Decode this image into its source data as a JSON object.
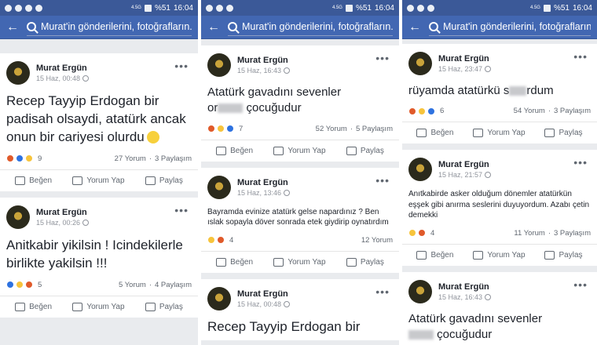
{
  "status": {
    "time": "16:04",
    "battery": "%51",
    "network": "4.5G"
  },
  "search": {
    "text": "Murat'in gönderilerini, fotoğrafların..."
  },
  "actions": {
    "like": "Beğen",
    "comment": "Yorum Yap",
    "share": "Paylaş"
  },
  "panels": [
    {
      "posts": [
        {
          "author": "Murat Ergün",
          "time": "15 Haz, 00:48",
          "text": "Recep Tayyip Erdogan bir padisah olsaydi, atatürk ancak onun bir cariyesi olurdu",
          "reactions": "9",
          "comments": "27 Yorum",
          "shares": "3 Paylaşım"
        },
        {
          "author": "Murat Ergün",
          "time": "15 Haz, 00:26",
          "text": "Anitkabir yikilsin ! Icindekilerle birlikte yakilsin !!!",
          "reactions": "5",
          "comments": "5 Yorum",
          "shares": "4 Paylaşım"
        }
      ]
    },
    {
      "posts": [
        {
          "author": "Murat Ergün",
          "time": "15 Haz, 16:43",
          "text_a": "Atatürk gavadını sevenler",
          "text_b": "çocuğudur",
          "text_pre": "or",
          "reactions": "7",
          "comments": "52 Yorum",
          "shares": "5 Paylaşım"
        },
        {
          "author": "Murat Ergün",
          "time": "15 Haz, 13:46",
          "text": "Bayramda evinize atatürk gelse napardınız ? Ben ıslak sopayla döver sonrada etek giydirip oynatırdım",
          "reactions": "4",
          "comments": "12 Yorum"
        },
        {
          "author": "Murat Ergün",
          "time": "15 Haz, 00:48",
          "text": "Recep Tayyip Erdogan bir"
        }
      ]
    },
    {
      "posts": [
        {
          "author": "Murat Ergün",
          "time": "15 Haz, 23:47",
          "text_a": "rüyamda atatürkü s",
          "text_b": "rdum",
          "reactions": "6",
          "comments": "54 Yorum",
          "shares": "3 Paylaşım"
        },
        {
          "author": "Murat Ergün",
          "time": "15 Haz, 21:57",
          "text": "Anıtkabirde asker olduğum dönemler atatürkün eşşek gibi anırma seslerini duyuyordum. Azabı çetin demekki",
          "reactions": "4",
          "comments": "11 Yorum",
          "shares": "3 Paylaşım"
        },
        {
          "author": "Murat Ergün",
          "time": "15 Haz, 16:43",
          "text_a": "Atatürk gavadını sevenler",
          "text_b": "çocuğudur"
        }
      ]
    }
  ]
}
